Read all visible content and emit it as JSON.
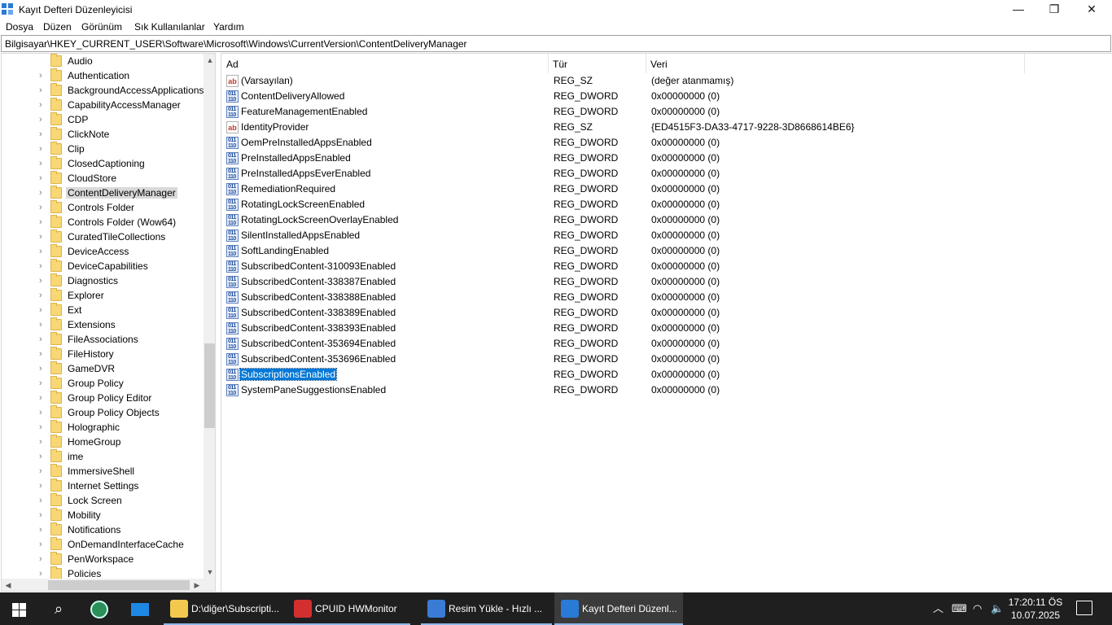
{
  "window": {
    "title": "Kayıt Defteri Düzenleyicisi",
    "minimize": "—",
    "maximize": "❐",
    "close": "✕"
  },
  "menu": [
    "Dosya",
    "Düzen",
    "Görünüm",
    "Sık Kullanılanlar",
    "Yardım"
  ],
  "address": "Bilgisayar\\HKEY_CURRENT_USER\\Software\\Microsoft\\Windows\\CurrentVersion\\ContentDeliveryManager",
  "tree": {
    "items": [
      {
        "label": "Audio",
        "expandable": false
      },
      {
        "label": "Authentication",
        "expandable": true
      },
      {
        "label": "BackgroundAccessApplications",
        "expandable": true
      },
      {
        "label": "CapabilityAccessManager",
        "expandable": true
      },
      {
        "label": "CDP",
        "expandable": true
      },
      {
        "label": "ClickNote",
        "expandable": true
      },
      {
        "label": "Clip",
        "expandable": true
      },
      {
        "label": "ClosedCaptioning",
        "expandable": true
      },
      {
        "label": "CloudStore",
        "expandable": true
      },
      {
        "label": "ContentDeliveryManager",
        "expandable": true,
        "selected": true
      },
      {
        "label": "Controls Folder",
        "expandable": true
      },
      {
        "label": "Controls Folder (Wow64)",
        "expandable": true
      },
      {
        "label": "CuratedTileCollections",
        "expandable": true
      },
      {
        "label": "DeviceAccess",
        "expandable": true
      },
      {
        "label": "DeviceCapabilities",
        "expandable": true
      },
      {
        "label": "Diagnostics",
        "expandable": true
      },
      {
        "label": "Explorer",
        "expandable": true
      },
      {
        "label": "Ext",
        "expandable": true
      },
      {
        "label": "Extensions",
        "expandable": true
      },
      {
        "label": "FileAssociations",
        "expandable": true
      },
      {
        "label": "FileHistory",
        "expandable": true
      },
      {
        "label": "GameDVR",
        "expandable": true
      },
      {
        "label": "Group Policy",
        "expandable": true
      },
      {
        "label": "Group Policy Editor",
        "expandable": true
      },
      {
        "label": "Group Policy Objects",
        "expandable": true
      },
      {
        "label": "Holographic",
        "expandable": true
      },
      {
        "label": "HomeGroup",
        "expandable": true
      },
      {
        "label": "ime",
        "expandable": true
      },
      {
        "label": "ImmersiveShell",
        "expandable": true
      },
      {
        "label": "Internet Settings",
        "expandable": true
      },
      {
        "label": "Lock Screen",
        "expandable": true
      },
      {
        "label": "Mobility",
        "expandable": true
      },
      {
        "label": "Notifications",
        "expandable": true
      },
      {
        "label": "OnDemandInterfaceCache",
        "expandable": true
      },
      {
        "label": "PenWorkspace",
        "expandable": true
      },
      {
        "label": "Policies",
        "expandable": true
      }
    ]
  },
  "list": {
    "columns": {
      "name": "Ad",
      "type": "Tür",
      "data": "Veri"
    },
    "rows": [
      {
        "name": "(Varsayılan)",
        "type": "REG_SZ",
        "data": "(değer atanmamış)",
        "icon": "string-value-icon"
      },
      {
        "name": "ContentDeliveryAllowed",
        "type": "REG_DWORD",
        "data": "0x00000000 (0)",
        "icon": "dword-value-icon"
      },
      {
        "name": "FeatureManagementEnabled",
        "type": "REG_DWORD",
        "data": "0x00000000 (0)",
        "icon": "dword-value-icon"
      },
      {
        "name": "IdentityProvider",
        "type": "REG_SZ",
        "data": "{ED4515F3-DA33-4717-9228-3D8668614BE6}",
        "icon": "string-value-icon"
      },
      {
        "name": "OemPreInstalledAppsEnabled",
        "type": "REG_DWORD",
        "data": "0x00000000 (0)",
        "icon": "dword-value-icon"
      },
      {
        "name": "PreInstalledAppsEnabled",
        "type": "REG_DWORD",
        "data": "0x00000000 (0)",
        "icon": "dword-value-icon"
      },
      {
        "name": "PreInstalledAppsEverEnabled",
        "type": "REG_DWORD",
        "data": "0x00000000 (0)",
        "icon": "dword-value-icon"
      },
      {
        "name": "RemediationRequired",
        "type": "REG_DWORD",
        "data": "0x00000000 (0)",
        "icon": "dword-value-icon"
      },
      {
        "name": "RotatingLockScreenEnabled",
        "type": "REG_DWORD",
        "data": "0x00000000 (0)",
        "icon": "dword-value-icon"
      },
      {
        "name": "RotatingLockScreenOverlayEnabled",
        "type": "REG_DWORD",
        "data": "0x00000000 (0)",
        "icon": "dword-value-icon"
      },
      {
        "name": "SilentInstalledAppsEnabled",
        "type": "REG_DWORD",
        "data": "0x00000000 (0)",
        "icon": "dword-value-icon"
      },
      {
        "name": "SoftLandingEnabled",
        "type": "REG_DWORD",
        "data": "0x00000000 (0)",
        "icon": "dword-value-icon"
      },
      {
        "name": "SubscribedContent-310093Enabled",
        "type": "REG_DWORD",
        "data": "0x00000000 (0)",
        "icon": "dword-value-icon"
      },
      {
        "name": "SubscribedContent-338387Enabled",
        "type": "REG_DWORD",
        "data": "0x00000000 (0)",
        "icon": "dword-value-icon"
      },
      {
        "name": "SubscribedContent-338388Enabled",
        "type": "REG_DWORD",
        "data": "0x00000000 (0)",
        "icon": "dword-value-icon"
      },
      {
        "name": "SubscribedContent-338389Enabled",
        "type": "REG_DWORD",
        "data": "0x00000000 (0)",
        "icon": "dword-value-icon"
      },
      {
        "name": "SubscribedContent-338393Enabled",
        "type": "REG_DWORD",
        "data": "0x00000000 (0)",
        "icon": "dword-value-icon"
      },
      {
        "name": "SubscribedContent-353694Enabled",
        "type": "REG_DWORD",
        "data": "0x00000000 (0)",
        "icon": "dword-value-icon"
      },
      {
        "name": "SubscribedContent-353696Enabled",
        "type": "REG_DWORD",
        "data": "0x00000000 (0)",
        "icon": "dword-value-icon"
      },
      {
        "name": "SubscriptionsEnabled",
        "type": "REG_DWORD",
        "data": "0x00000000 (0)",
        "icon": "dword-value-icon",
        "selected": true
      },
      {
        "name": "SystemPaneSuggestionsEnabled",
        "type": "REG_DWORD",
        "data": "0x00000000 (0)",
        "icon": "dword-value-icon"
      }
    ]
  },
  "taskbar": {
    "tasks": [
      {
        "label": "D:\\diğer\\Subscripti...",
        "icon": "folder-icon",
        "color": "#f2c94c"
      },
      {
        "label": "CPUID HWMonitor",
        "icon": "hwmonitor-icon",
        "color": "#d32f2f"
      },
      {
        "label": "Resim Yükle - Hızlı ...",
        "icon": "browser-icon",
        "color": "#3a7bd5"
      },
      {
        "label": "Kayıt Defteri Düzenl...",
        "icon": "regedit-icon",
        "color": "#2a7bd6"
      }
    ],
    "clock_time": "17:20:11 ÖS",
    "clock_date": "10.07.2025"
  },
  "colors": {
    "selection": "#0078d7",
    "taskbar": "#1f1f1f"
  }
}
